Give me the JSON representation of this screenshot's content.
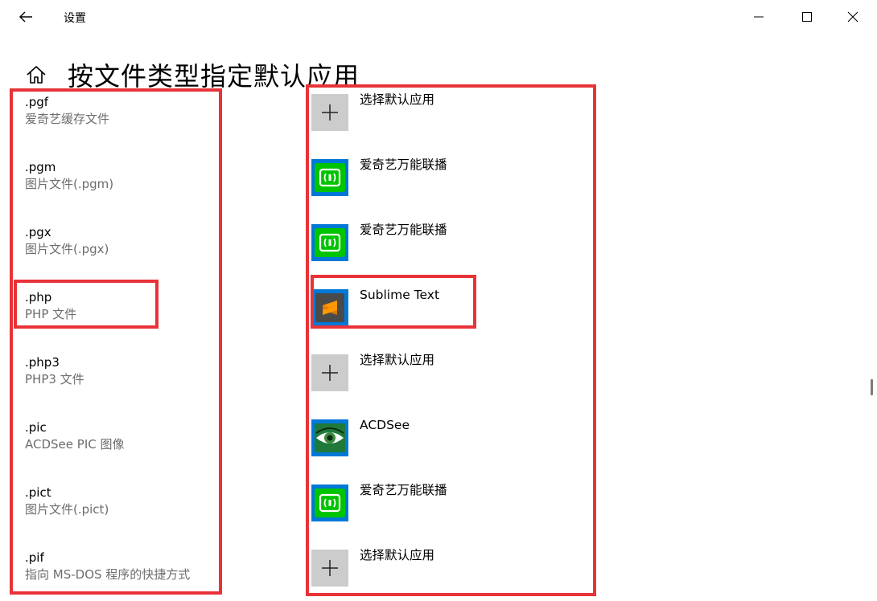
{
  "window": {
    "title": "设置"
  },
  "page": {
    "title": "按文件类型指定默认应用"
  },
  "icons": {
    "back": "back-arrow-icon",
    "minimize": "minimize-icon",
    "maximize": "maximize-icon",
    "close": "close-icon",
    "home": "home-icon",
    "plus": "plus-icon",
    "iqiyi": "iqiyi-cast-icon",
    "sublime": "sublime-text-icon",
    "acdsee": "acdsee-eye-icon"
  },
  "colors": {
    "highlight": "#e83338",
    "tile_blue": "#0078d7",
    "tile_gray": "#cccccc",
    "iqiyi_green": "#00c400"
  },
  "file_types": [
    {
      "ext": ".pgf",
      "desc": "爱奇艺缓存文件"
    },
    {
      "ext": ".pgm",
      "desc": "图片文件(.pgm)"
    },
    {
      "ext": ".pgx",
      "desc": "图片文件(.pgx)"
    },
    {
      "ext": ".php",
      "desc": "PHP 文件"
    },
    {
      "ext": ".php3",
      "desc": "PHP3 文件"
    },
    {
      "ext": ".pic",
      "desc": "ACDSee PIC 图像"
    },
    {
      "ext": ".pict",
      "desc": "图片文件(.pict)"
    },
    {
      "ext": ".pif",
      "desc": "指向 MS-DOS 程序的快捷方式"
    }
  ],
  "default_apps": [
    {
      "name": "选择默认应用",
      "icon": "plus-icon"
    },
    {
      "name": "爱奇艺万能联播",
      "icon": "iqiyi-cast-icon"
    },
    {
      "name": "爱奇艺万能联播",
      "icon": "iqiyi-cast-icon"
    },
    {
      "name": "Sublime Text",
      "icon": "sublime-text-icon"
    },
    {
      "name": "选择默认应用",
      "icon": "plus-icon"
    },
    {
      "name": "ACDSee",
      "icon": "acdsee-eye-icon"
    },
    {
      "name": "爱奇艺万能联播",
      "icon": "iqiyi-cast-icon"
    },
    {
      "name": "选择默认应用",
      "icon": "plus-icon"
    }
  ]
}
